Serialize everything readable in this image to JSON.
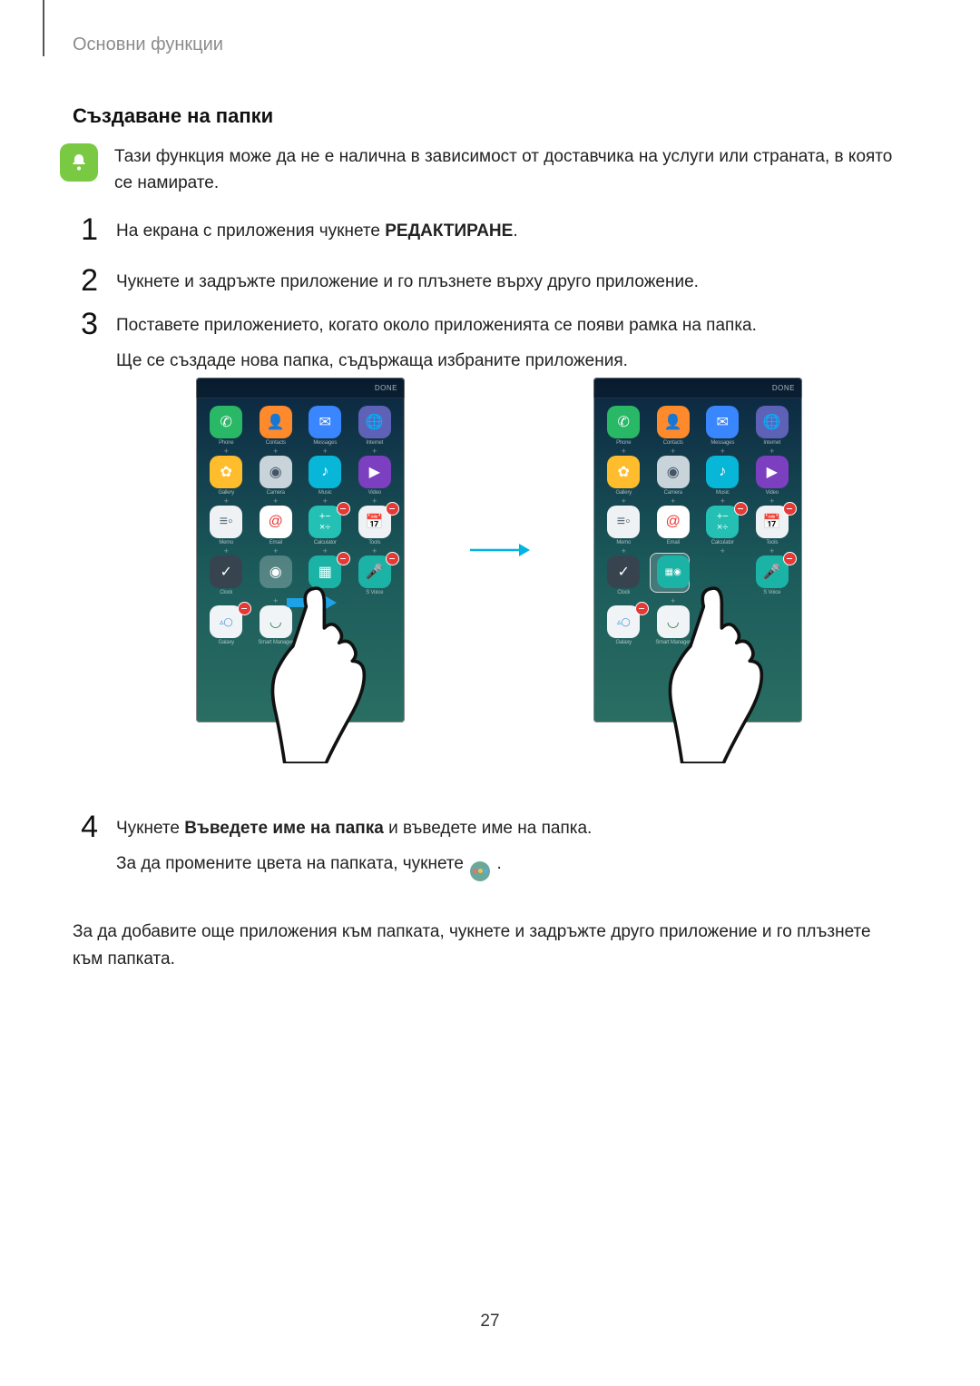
{
  "breadcrumb": "Основни функции",
  "heading": "Създаване на папки",
  "note": "Тази функция може да не е налична в зависимост от доставчика на услуги или страната, в която се намирате.",
  "steps": {
    "s1": {
      "num": "1",
      "pre": "На екрана с приложения чукнете ",
      "bold": "РЕДАКТИРАНЕ",
      "post": "."
    },
    "s2": {
      "num": "2",
      "text": "Чукнете и задръжте приложение и го плъзнете върху друго приложение."
    },
    "s3": {
      "num": "3",
      "line1": "Поставете приложението, когато около приложенията се появи рамка на папка.",
      "line2": "Ще се създаде нова папка, съдържаща избраните приложения."
    },
    "s4": {
      "num": "4",
      "pre": "Чукнете ",
      "bold": "Въведете име на папка",
      "post": " и въведете име на папка.",
      "line2a": "За да промените цвета на папката, чукнете ",
      "line2b": "."
    }
  },
  "bottom": "За да добавите още приложения към папката, чукнете и задръжте друго приложение и го плъзнете към папката.",
  "page_number": "27",
  "phone": {
    "done": "DONE",
    "apps": [
      {
        "label": "Phone"
      },
      {
        "label": "Contacts"
      },
      {
        "label": "Messages"
      },
      {
        "label": "Internet"
      },
      {
        "label": "Gallery"
      },
      {
        "label": "Camera"
      },
      {
        "label": "Music"
      },
      {
        "label": "Video"
      },
      {
        "label": "Memo"
      },
      {
        "label": "Email"
      },
      {
        "label": "Calculator"
      },
      {
        "label": "Tools"
      },
      {
        "label": "Clock"
      },
      {
        "label": ""
      },
      {
        "label": ""
      },
      {
        "label": "S Voice"
      },
      {
        "label": "Galaxy"
      },
      {
        "label": "Smart Manager"
      }
    ],
    "galaxy": "Galaxy"
  }
}
